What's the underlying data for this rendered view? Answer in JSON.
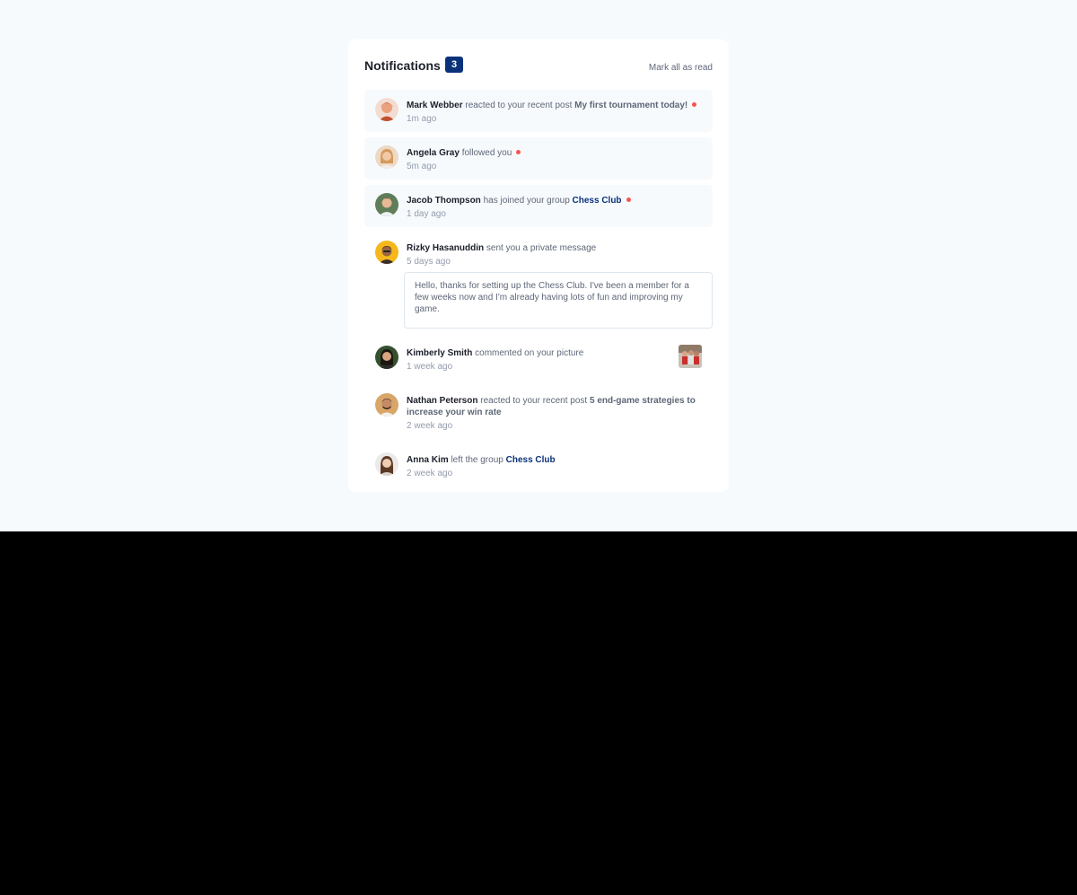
{
  "header": {
    "title": "Notifications",
    "unread_count": "3",
    "mark_all_label": "Mark all as read"
  },
  "notifications": [
    {
      "name": "Mark Webber",
      "action": " reacted to your recent post ",
      "target": "My first tournament today!",
      "time": "1m ago",
      "unread": true
    },
    {
      "name": "Angela Gray",
      "action": " followed you",
      "time": "5m ago",
      "unread": true
    },
    {
      "name": "Jacob Thompson",
      "action": " has joined your group ",
      "target": "Chess Club",
      "time": "1 day ago",
      "unread": true
    },
    {
      "name": "Rizky Hasanuddin",
      "action": " sent you a private message",
      "time": "5 days ago",
      "unread": false,
      "message": "Hello, thanks for setting up the Chess Club. I've been a member for a few weeks now and I'm already having lots of fun and improving my game."
    },
    {
      "name": "Kimberly Smith",
      "action": " commented on your picture",
      "time": "1 week ago",
      "unread": false
    },
    {
      "name": "Nathan Peterson",
      "action": " reacted to your recent post ",
      "target": "5 end-game strategies to increase your win rate",
      "time": "2 week ago",
      "unread": false
    },
    {
      "name": "Anna Kim",
      "action": " left the group ",
      "target": "Chess Club",
      "time": "2 week ago",
      "unread": false
    }
  ],
  "colors": {
    "accent": "#0a327b",
    "unread_dot": "#f65552",
    "unread_bg": "#f7fafd",
    "text_dark": "#1c202b",
    "text_muted": "#5e6778"
  }
}
